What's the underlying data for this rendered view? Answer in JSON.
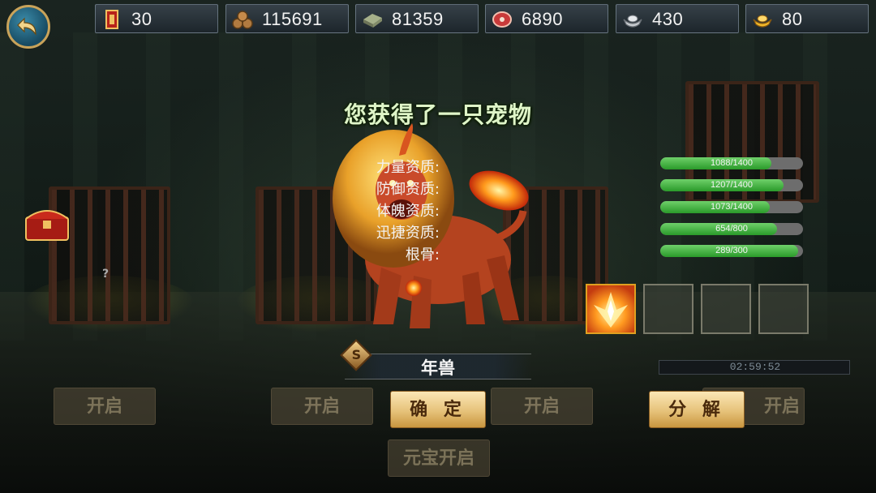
{
  "header": {
    "back_icon": "back-arrow-icon",
    "resources": [
      {
        "icon": "token-scroll-icon",
        "value": "30"
      },
      {
        "icon": "wood-logs-icon",
        "value": "115691"
      },
      {
        "icon": "stone-block-icon",
        "value": "81359"
      },
      {
        "icon": "meat-food-icon",
        "value": "6890"
      },
      {
        "icon": "silver-ingot-icon",
        "value": "430"
      },
      {
        "icon": "gold-ingot-icon",
        "value": "80"
      }
    ]
  },
  "dialog": {
    "title": "您获得了一只宠物",
    "pet": {
      "grade": "S",
      "name": "年兽"
    },
    "stats": [
      {
        "label": "力量资质:",
        "value": 1088,
        "max": 1400,
        "text": "1088/1400"
      },
      {
        "label": "防御资质:",
        "value": 1207,
        "max": 1400,
        "text": "1207/1400"
      },
      {
        "label": "体魄资质:",
        "value": 1073,
        "max": 1400,
        "text": "1073/1400"
      },
      {
        "label": "迅捷资质:",
        "value": 654,
        "max": 800,
        "text": "654/800"
      },
      {
        "label": "根骨:",
        "value": 289,
        "max": 300,
        "text": "289/300"
      }
    ],
    "skills": [
      {
        "icon": "fire-burst-skill-icon",
        "filled": true
      },
      {
        "icon": "empty-skill-slot",
        "filled": false
      },
      {
        "icon": "empty-skill-slot",
        "filled": false
      },
      {
        "icon": "empty-skill-slot",
        "filled": false
      }
    ],
    "confirm_label": "确 定",
    "decompose_label": "分 解"
  },
  "background": {
    "open_label_1": "开启",
    "open_label_2": "开启",
    "open_label_3": "开启",
    "open_label_4": "开启",
    "ingot_open_label": "元宝开启",
    "timer": "02:59:52"
  }
}
